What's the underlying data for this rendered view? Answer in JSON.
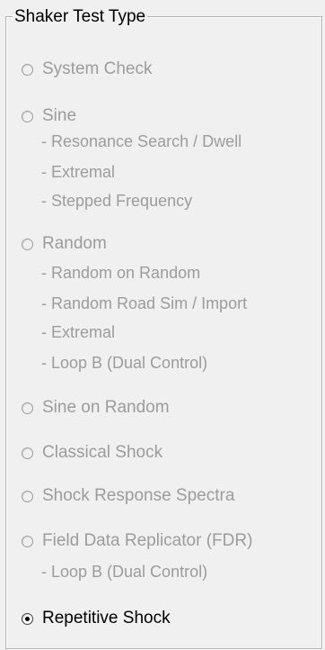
{
  "group": {
    "title": "Shaker Test Type"
  },
  "options": [
    {
      "label": "System Check",
      "enabled": false,
      "checked": false
    },
    {
      "label": "Sine",
      "enabled": false,
      "checked": false,
      "sub": [
        "- Resonance Search / Dwell",
        "- Extremal",
        "- Stepped Frequency"
      ]
    },
    {
      "label": "Random",
      "enabled": false,
      "checked": false,
      "sub": [
        "- Random on Random",
        "- Random Road Sim / Import",
        "- Extremal",
        "- Loop B (Dual Control)"
      ]
    },
    {
      "label": "Sine on Random",
      "enabled": false,
      "checked": false
    },
    {
      "label": "Classical Shock",
      "enabled": false,
      "checked": false
    },
    {
      "label": "Shock Response Spectra",
      "enabled": false,
      "checked": false
    },
    {
      "label": "Field Data Replicator (FDR)",
      "enabled": false,
      "checked": false,
      "sub": [
        "- Loop B (Dual Control)"
      ]
    },
    {
      "label": "Repetitive Shock",
      "enabled": true,
      "checked": true
    }
  ]
}
